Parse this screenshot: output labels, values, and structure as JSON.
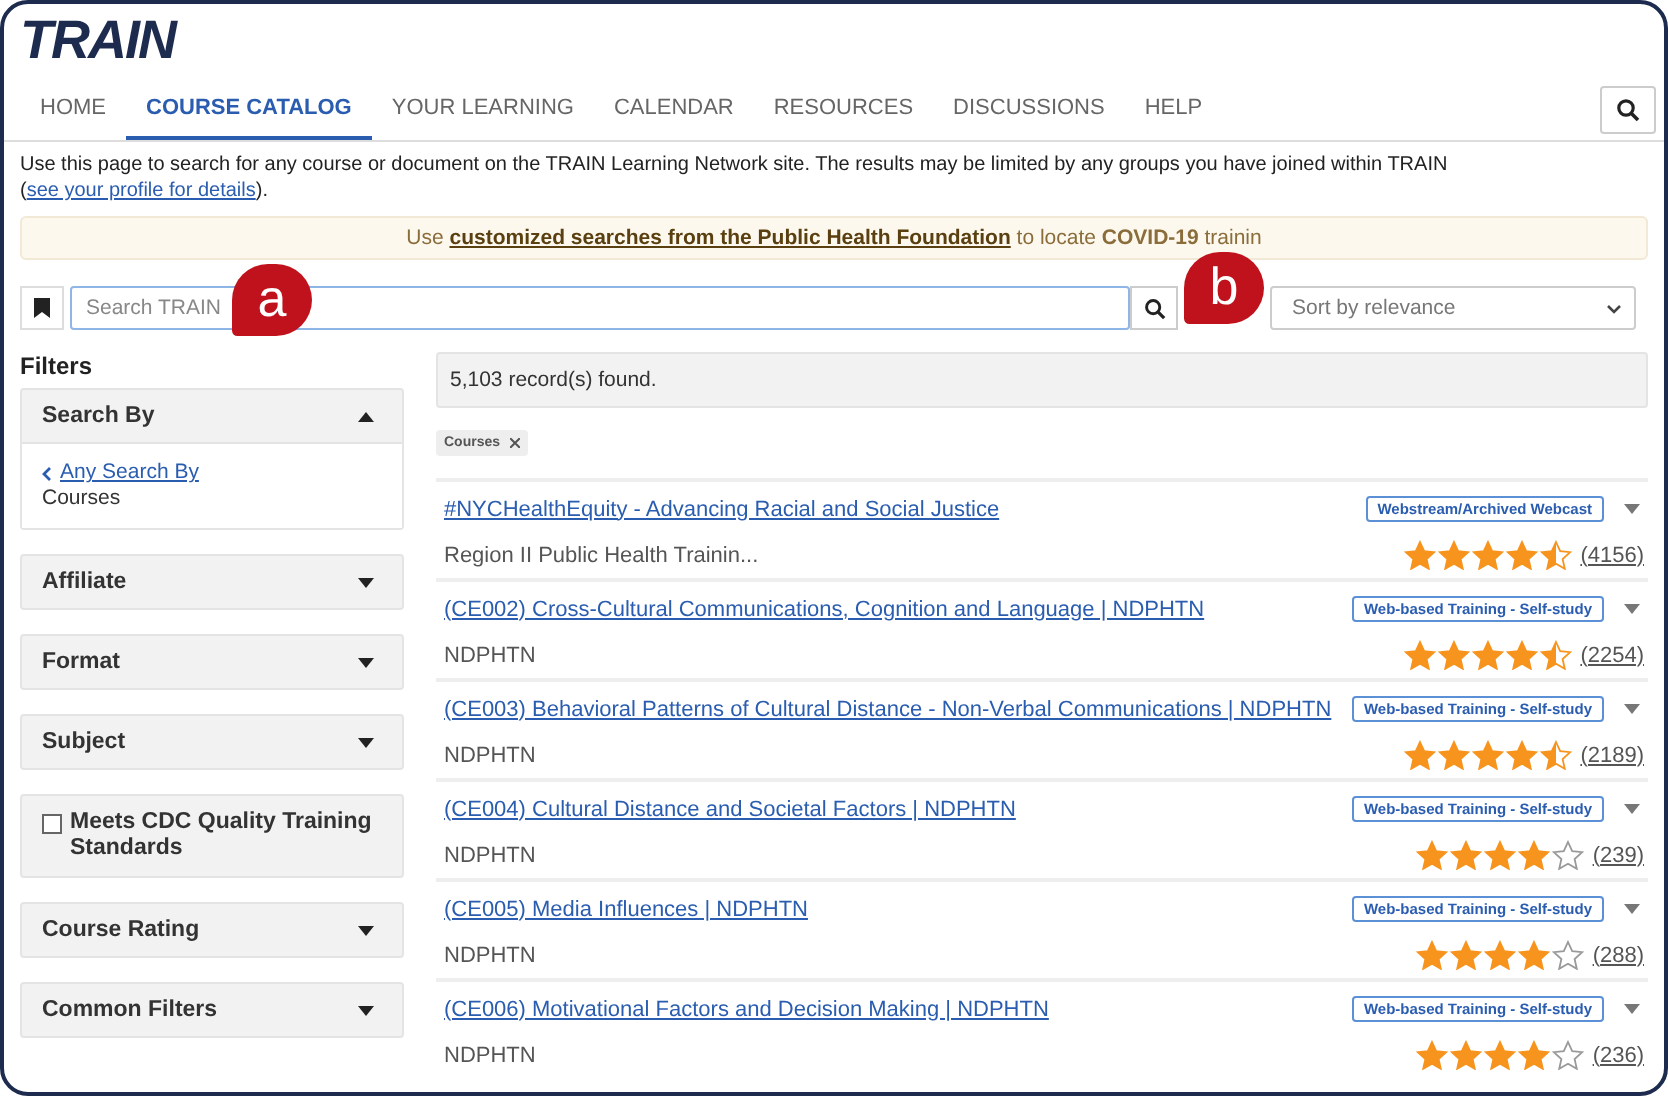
{
  "logo": "TRAIN",
  "nav": {
    "tabs": [
      {
        "label": "HOME",
        "selected": false
      },
      {
        "label": "COURSE CATALOG",
        "selected": true
      },
      {
        "label": "YOUR LEARNING",
        "selected": false
      },
      {
        "label": "CALENDAR",
        "selected": false
      },
      {
        "label": "RESOURCES",
        "selected": false
      },
      {
        "label": "DISCUSSIONS",
        "selected": false
      },
      {
        "label": "HELP",
        "selected": false
      }
    ]
  },
  "intro": {
    "text": "Use this page to search for any course or document on the TRAIN Learning Network site. The results may be limited by any groups you have joined within TRAIN (",
    "link": "see your profile for details",
    "after": ")."
  },
  "banner": {
    "before": "Use ",
    "link": "customized searches from the Public Health Foundation",
    "after": " to locate **COVID-19** trainin"
  },
  "search": {
    "placeholder": "Search TRAIN",
    "sort": "Sort by relevance"
  },
  "callouts": [
    {
      "label": "a"
    },
    {
      "label": "b"
    }
  ],
  "filters": {
    "title": "Filters",
    "items": [
      {
        "kind": "collapsible",
        "label": "Search By",
        "expanded": true,
        "back_link": "Any Search By",
        "value": "Courses"
      },
      {
        "kind": "collapsible",
        "label": "Affiliate",
        "expanded": false
      },
      {
        "kind": "collapsible",
        "label": "Format",
        "expanded": false
      },
      {
        "kind": "collapsible",
        "label": "Subject",
        "expanded": false
      },
      {
        "kind": "checkbox",
        "label": "Meets CDC Quality Training Standards",
        "checked": false
      },
      {
        "kind": "collapsible",
        "label": "Course Rating",
        "expanded": false
      },
      {
        "kind": "collapsible",
        "label": "Common Filters",
        "expanded": false
      }
    ]
  },
  "results": {
    "count": "5,103 record(s) found.",
    "chips": [
      {
        "label": "Courses"
      }
    ],
    "rows": [
      {
        "title": "#NYCHealthEquity - Advancing Racial and Social Justice",
        "provider": "Region II Public Health Trainin...",
        "type": "Webstream/Archived Webcast",
        "stars": 4.5,
        "reviews": "(4156)"
      },
      {
        "title": "(CE002) Cross-Cultural Communications, Cognition and Language | NDPHTN",
        "provider": "NDPHTN",
        "type": "Web-based Training - Self-study",
        "stars": 4.5,
        "reviews": "(2254)"
      },
      {
        "title": "(CE003) Behavioral Patterns of Cultural Distance - Non-Verbal Communications | NDPHTN",
        "provider": "NDPHTN",
        "type": "Web-based Training - Self-study",
        "stars": 4.5,
        "reviews": "(2189)"
      },
      {
        "title": "(CE004) Cultural Distance and Societal Factors | NDPHTN",
        "provider": "NDPHTN",
        "type": "Web-based Training - Self-study",
        "stars": 4,
        "reviews": "(239)"
      },
      {
        "title": "(CE005) Media Influences | NDPHTN",
        "provider": "NDPHTN",
        "type": "Web-based Training - Self-study",
        "stars": 4,
        "reviews": "(288)"
      },
      {
        "title": "(CE006) Motivational Factors and Decision Making | NDPHTN",
        "provider": "NDPHTN",
        "type": "Web-based Training - Self-study",
        "stars": 4,
        "reviews": "(236)"
      }
    ]
  }
}
